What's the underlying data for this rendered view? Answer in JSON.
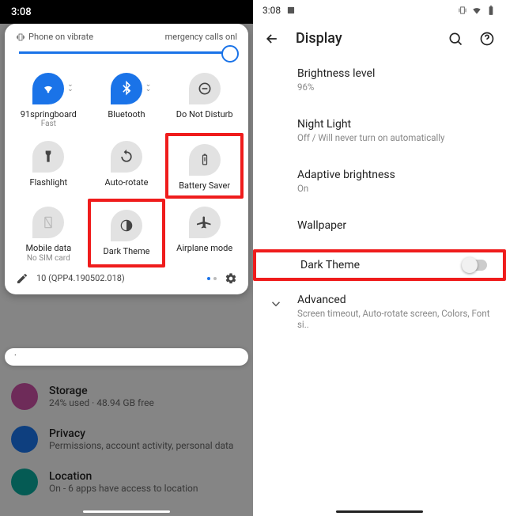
{
  "left": {
    "status_time": "3:08",
    "panel": {
      "vibrate_text": "Phone on vibrate",
      "emergency_text": "mergency calls onl",
      "tiles": [
        {
          "label": "91springboard",
          "sub": "Fast",
          "state": "on",
          "interact": true,
          "name": "wifi-tile",
          "icon": "wifi",
          "chev": true
        },
        {
          "label": "Bluetooth",
          "sub": "",
          "state": "on",
          "interact": true,
          "name": "bluetooth-tile",
          "icon": "bluetooth",
          "chev": true
        },
        {
          "label": "Do Not Disturb",
          "sub": "",
          "state": "off",
          "interact": true,
          "name": "dnd-tile",
          "icon": "dnd",
          "chev": false
        },
        {
          "label": "Flashlight",
          "sub": "",
          "state": "off",
          "interact": true,
          "name": "flashlight-tile",
          "icon": "flashlight",
          "chev": false
        },
        {
          "label": "Auto-rotate",
          "sub": "",
          "state": "off",
          "interact": true,
          "name": "autorotate-tile",
          "icon": "rotate",
          "chev": false
        },
        {
          "label": "Battery Saver",
          "sub": "",
          "state": "off",
          "interact": true,
          "name": "battery-saver-tile",
          "icon": "battery",
          "chev": false,
          "hl": true
        },
        {
          "label": "Mobile data",
          "sub": "No SIM card",
          "state": "dis",
          "interact": false,
          "name": "mobile-data-tile",
          "icon": "sim",
          "chev": false
        },
        {
          "label": "Dark Theme",
          "sub": "",
          "state": "off",
          "interact": true,
          "name": "dark-theme-tile",
          "icon": "darktheme",
          "chev": false,
          "hl": true
        },
        {
          "label": "Airplane mode",
          "sub": "",
          "state": "off",
          "interact": true,
          "name": "airplane-tile",
          "icon": "airplane",
          "chev": false
        }
      ],
      "build": "10 (QPP4.190502.018)"
    },
    "bg_rows": [
      {
        "title": "Storage",
        "sub": "24% used · 48.94 GB free",
        "color": "#c84fa2"
      },
      {
        "title": "Privacy",
        "sub": "Permissions, account activity, personal data",
        "color": "#1a73e8"
      },
      {
        "title": "Location",
        "sub": "On - 6 apps have access to location",
        "color": "#0aa79a"
      }
    ]
  },
  "right": {
    "status_time": "3:08",
    "title": "Display",
    "rows": [
      {
        "title": "Brightness level",
        "sub": "96%",
        "name": "brightness-row",
        "interact": true
      },
      {
        "title": "Night Light",
        "sub": "Off / Will never turn on automatically",
        "name": "night-light-row",
        "interact": true
      },
      {
        "title": "Adaptive brightness",
        "sub": "On",
        "name": "adaptive-brightness-row",
        "interact": true
      },
      {
        "title": "Wallpaper",
        "sub": "",
        "name": "wallpaper-row",
        "interact": true
      },
      {
        "title": "Dark Theme",
        "sub": "",
        "name": "dark-theme-row",
        "interact": true,
        "toggle": true,
        "hl": true
      },
      {
        "title": "Advanced",
        "sub": "Screen timeout, Auto-rotate screen, Colors, Font si..",
        "name": "advanced-row",
        "interact": true,
        "expander": true
      }
    ]
  },
  "colors": {
    "accent": "#1a73e8",
    "highlight": "#ef1c1c"
  }
}
